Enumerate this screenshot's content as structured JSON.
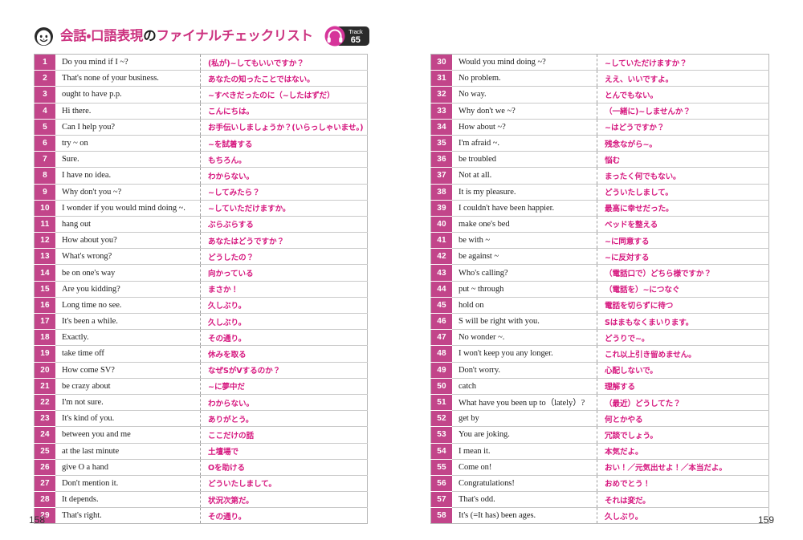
{
  "header": {
    "title_accent_1": "会話・口語表現",
    "title_plain": "の",
    "title_accent_2": "ファイナルチェックリスト",
    "face_icon": "smiling-face-icon",
    "headphone_icon": "headphone-icon",
    "track_label": "Track",
    "track_number": "65"
  },
  "colors": {
    "accent_pink": "#cc3380",
    "number_cell_bg": "#c2458a",
    "japanese_text": "#d6187f",
    "english_text": "#1a1a1a",
    "badge_bg": "#2b2b2b",
    "table_border": "#b8b8b8"
  },
  "folio": {
    "left_page": "158",
    "right_page": "159"
  },
  "left_table": {
    "rows": [
      {
        "no": "1",
        "en": "Do you mind if I ~?",
        "jp": "(私が)~してもいいですか？"
      },
      {
        "no": "2",
        "en": "That's none of your business.",
        "jp": "あなたの知ったことではない。"
      },
      {
        "no": "3",
        "en": "ought to have p.p.",
        "jp": "~すべきだったのに（~したはずだ）"
      },
      {
        "no": "4",
        "en": "Hi there.",
        "jp": "こんにちは。"
      },
      {
        "no": "5",
        "en": "Can I help you?",
        "jp": "お手伝いしましょうか？(いらっしゃいませ。)"
      },
      {
        "no": "6",
        "en": "try ~ on",
        "jp": "~を試着する"
      },
      {
        "no": "7",
        "en": "Sure.",
        "jp": "もちろん。"
      },
      {
        "no": "8",
        "en": "I have no idea.",
        "jp": "わからない。"
      },
      {
        "no": "9",
        "en": "Why don't you ~?",
        "jp": "~してみたら？"
      },
      {
        "no": "10",
        "en": "I wonder if you would mind doing ~.",
        "jp": "~していただけますか。"
      },
      {
        "no": "11",
        "en": "hang out",
        "jp": "ぶらぶらする"
      },
      {
        "no": "12",
        "en": "How about you?",
        "jp": "あなたはどうですか？"
      },
      {
        "no": "13",
        "en": "What's wrong?",
        "jp": "どうしたの？"
      },
      {
        "no": "14",
        "en": "be on one's way",
        "jp": "向かっている"
      },
      {
        "no": "15",
        "en": "Are you kidding?",
        "jp": "まさか！"
      },
      {
        "no": "16",
        "en": "Long time no see.",
        "jp": "久しぶり。"
      },
      {
        "no": "17",
        "en": "It's been a while.",
        "jp": "久しぶり。"
      },
      {
        "no": "18",
        "en": "Exactly.",
        "jp": "その通り。"
      },
      {
        "no": "19",
        "en": "take time off",
        "jp": "休みを取る"
      },
      {
        "no": "20",
        "en": "How come SV?",
        "jp": "なぜSがVするのか？"
      },
      {
        "no": "21",
        "en": "be crazy about",
        "jp": "~に夢中だ"
      },
      {
        "no": "22",
        "en": "I'm not sure.",
        "jp": "わからない。"
      },
      {
        "no": "23",
        "en": "It's kind of you.",
        "jp": "ありがとう。"
      },
      {
        "no": "24",
        "en": "between you and me",
        "jp": "ここだけの話"
      },
      {
        "no": "25",
        "en": "at the last minute",
        "jp": "土壇場で"
      },
      {
        "no": "26",
        "en": "give O a hand",
        "jp": "Oを助ける"
      },
      {
        "no": "27",
        "en": "Don't mention it.",
        "jp": "どういたしまして。"
      },
      {
        "no": "28",
        "en": "It depends.",
        "jp": "状況次第だ。"
      },
      {
        "no": "29",
        "en": "That's right.",
        "jp": "その通り。"
      }
    ]
  },
  "right_table": {
    "rows": [
      {
        "no": "30",
        "en": "Would you mind doing ~?",
        "jp": "~していただけますか？"
      },
      {
        "no": "31",
        "en": "No problem.",
        "jp": "ええ、いいですよ。"
      },
      {
        "no": "32",
        "en": "No way.",
        "jp": "とんでもない。"
      },
      {
        "no": "33",
        "en": "Why don't we ~?",
        "jp": "（一緒に)~しませんか？"
      },
      {
        "no": "34",
        "en": "How about ~?",
        "jp": "~はどうですか？"
      },
      {
        "no": "35",
        "en": "I'm afraid ~.",
        "jp": "残念ながら~。"
      },
      {
        "no": "36",
        "en": "be troubled",
        "jp": "悩む"
      },
      {
        "no": "37",
        "en": "Not at all.",
        "jp": "まったく何でもない。"
      },
      {
        "no": "38",
        "en": "It is my pleasure.",
        "jp": "どういたしまして。"
      },
      {
        "no": "39",
        "en": "I couldn't have been happier.",
        "jp": "最高に幸せだった。"
      },
      {
        "no": "40",
        "en": "make one's bed",
        "jp": "ベッドを整える"
      },
      {
        "no": "41",
        "en": "be with ~",
        "jp": "~に同意する"
      },
      {
        "no": "42",
        "en": "be against ~",
        "jp": "~に反対する"
      },
      {
        "no": "43",
        "en": "Who's calling?",
        "jp": "（電話口で）どちら様ですか？"
      },
      {
        "no": "44",
        "en": "put ~ through",
        "jp": "（電話を）~につなぐ"
      },
      {
        "no": "45",
        "en": "hold on",
        "jp": "電話を切らずに待つ"
      },
      {
        "no": "46",
        "en": "S will be right with you.",
        "jp": "Sはまもなくまいります。"
      },
      {
        "no": "47",
        "en": "No wonder ~.",
        "jp": "どうりで~。"
      },
      {
        "no": "48",
        "en": "I won't keep you any longer.",
        "jp": "これ以上引き留めません。"
      },
      {
        "no": "49",
        "en": "Don't worry.",
        "jp": "心配しないで。"
      },
      {
        "no": "50",
        "en": "catch",
        "jp": "理解する"
      },
      {
        "no": "51",
        "en": "What have you been up to（lately）?",
        "jp": "（最近）どうしてた？"
      },
      {
        "no": "52",
        "en": "get by",
        "jp": "何とかやる"
      },
      {
        "no": "53",
        "en": "You are joking.",
        "jp": "冗談でしょう。"
      },
      {
        "no": "54",
        "en": "I mean it.",
        "jp": "本気だよ。"
      },
      {
        "no": "55",
        "en": "Come on!",
        "jp": "おい！／元気出せよ！／本当だよ。"
      },
      {
        "no": "56",
        "en": "Congratulations!",
        "jp": "おめでとう！"
      },
      {
        "no": "57",
        "en": "That's odd.",
        "jp": "それは変だ。"
      },
      {
        "no": "58",
        "en": "It's (=It has) been ages.",
        "jp": "久しぶり。"
      }
    ]
  }
}
